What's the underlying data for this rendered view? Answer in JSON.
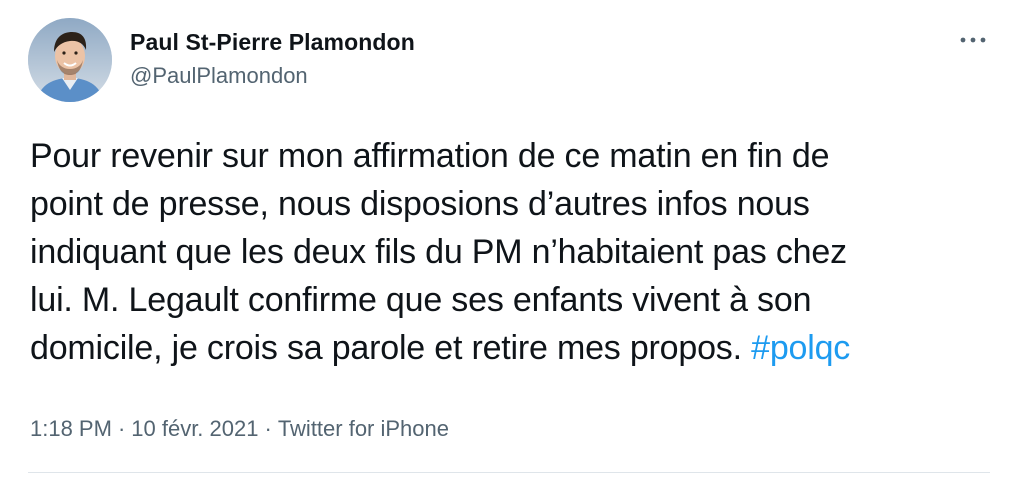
{
  "author": {
    "display_name": "Paul St-Pierre Plamondon",
    "handle": "@PaulPlamondon",
    "avatar_icon": "profile-photo"
  },
  "tweet": {
    "lines": [
      "Pour revenir sur mon affirmation de ce matin en fin de",
      "point de presse, nous disposions d’autres infos nous",
      "indiquant que les deux fils du PM n’habitaient pas chez",
      "lui. M. Legault confirme que ses enfants vivent à son",
      "domicile, je crois sa parole et retire mes propos."
    ],
    "hashtag": "#polqc"
  },
  "meta": {
    "time": "1:18 PM",
    "date": "10 févr. 2021",
    "source": "Twitter for iPhone",
    "separator": "·"
  },
  "colors": {
    "text": "#0f1419",
    "secondary": "#536471",
    "link": "#1d9bf0",
    "divider": "#dfe5ea"
  },
  "icons": {
    "more": "more-horizontal-icon"
  }
}
